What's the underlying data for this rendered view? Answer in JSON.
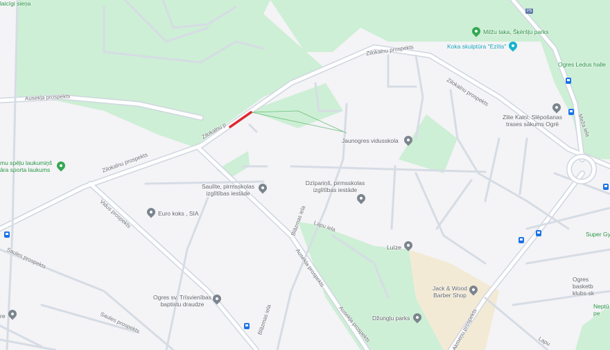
{
  "map": {
    "type": "street-map",
    "colors": {
      "background": "#f4f3f6",
      "park": "#cdefd5",
      "road": "#ffffff",
      "road_casing": "#cfd6e0",
      "highlight": "#e3242b",
      "commercial": "#f3ead5",
      "pin_grey": "#7b858e",
      "pin_green": "#34a853",
      "transit": "#1a73e8"
    },
    "streets": {
      "ausekla_top": "Ausekļa prospekts",
      "zilokalnu_top": "Zilokalnu prospekts",
      "zilokalnu_right": "Zilokalnu prospekts",
      "zilokalnu_mid": "Zilokalnu p",
      "zilokalnu_left": "Zilokalnu prospekts",
      "vidus": "Vidus prospekts",
      "saules_1": "Saules prospekts",
      "saules_2": "Saules prospekts",
      "blazmas_1": "Blāzmas iela",
      "blazmas_2": "Blāzmas iela",
      "ausekla_bottom": "Ausekļa prospekts",
      "lapu": "Lapu iela",
      "lapu_2": "Lapu",
      "meza": "Meža iela",
      "akmenu": "Akmeņu prospekts"
    },
    "places": {
      "milzu_taka": "Milžu taka, Šķēršļu parks",
      "koka_skulptura": "Koka skulptūra \"Ezītis\"",
      "ledus_halle": "Ogres Ledus halle",
      "zilie_kalni": "Zilie Kalni, Slēpošanas trases sākums Ogrē",
      "jaunogres": "Jaunogres vidusskola",
      "dziparins": "Dzīpariņš, pirmsskolas izglītības iestāde",
      "saulite": "Saulīte, pirmsskolas izglītības iestāde",
      "euro_koks": "Euro koks , SIA",
      "berno_speleu": "mu spēļu laukumiņš āra sporta laukums",
      "lulze": "Luīze",
      "jack_wood": "Jack & Wood Barber Shop",
      "dzunglu": "Džungļu parks",
      "baptistu": "Ogres sv. Trīsvienības baptistu draudze",
      "super_gym": "Super Gy",
      "basketbola": "Ogres basketb klubs-sk",
      "neptuns": "Neptū pe",
      "top_left": "laicīgi sieņa",
      "bottom_left": "re",
      "route_badge": "P5"
    }
  }
}
